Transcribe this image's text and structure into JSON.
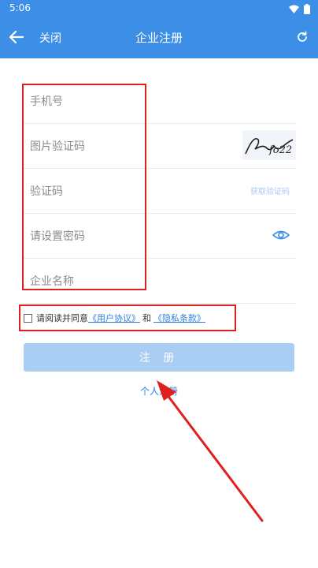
{
  "status_bar": {
    "time": "5:06"
  },
  "header": {
    "close_label": "关闭",
    "title": "企业注册",
    "back_icon": "arrow-left-icon",
    "refresh_icon": "refresh-icon"
  },
  "form": {
    "phone_placeholder": "手机号",
    "image_captcha_placeholder": "图片验证码",
    "captcha_image_text": "fo22",
    "sms_code_placeholder": "验证码",
    "get_code_label": "获取验证码",
    "password_placeholder": "请设置密码",
    "company_name_placeholder": "企业名称"
  },
  "agreement": {
    "prefix": "请阅读并同意",
    "user_agreement": "《用户协议》",
    "and": "和",
    "privacy": "《隐私条款》"
  },
  "register_button": "注 册",
  "personal_register_link": "个人注册",
  "colors": {
    "header_bg": "#3c8ee6",
    "link": "#2f7fe0",
    "button_disabled": "#aacdf3",
    "annotation_red": "#e02020"
  }
}
